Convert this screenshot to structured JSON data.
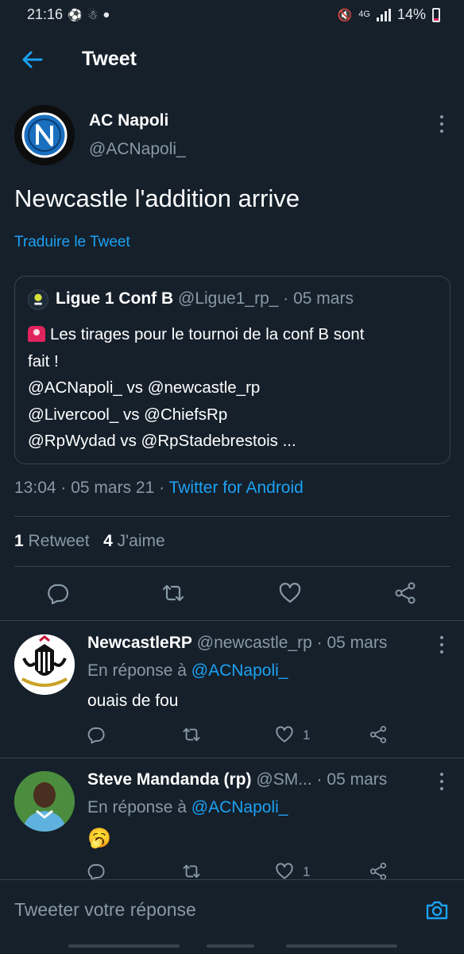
{
  "status_bar": {
    "time": "21:16",
    "network": "4G",
    "battery": "14%"
  },
  "header": {
    "title": "Tweet"
  },
  "tweet": {
    "author_name": "AC Napoli",
    "author_handle": "@ACNapoli_",
    "text": "Newcastle l'addition arrive",
    "translate_label": "Traduire le Tweet",
    "quoted": {
      "author_name": "Ligue 1 Conf B",
      "author_handle": "@Ligue1_rp_",
      "separator": " · ",
      "date": "05 mars",
      "lines": [
        "Les tirages pour le tournoi de la conf B sont",
        "fait !",
        "@ACNapoli_ vs @newcastle_rp",
        "@Livercool_ vs @ChiefsRp",
        "@RpWydad vs @RpStadebrestois ..."
      ]
    },
    "time": "13:04",
    "separator": " · ",
    "date": "05 mars 21",
    "source": "Twitter for Android",
    "retweets_count": "1",
    "retweets_label": "Retweet",
    "likes_count": "4",
    "likes_label": "J'aime"
  },
  "replies": [
    {
      "name": "NewcastleRP",
      "handle": "@newcastle_rp",
      "separator": " · ",
      "date": "05 mars",
      "reply_prefix": "En réponse à ",
      "reply_to": "@ACNapoli_",
      "text": "ouais de fou",
      "likes": "1"
    },
    {
      "name": "Steve Mandanda (rp)",
      "handle": "@SM...",
      "separator": " · ",
      "date": "05 mars",
      "reply_prefix": "En réponse à ",
      "reply_to": "@ACNapoli_",
      "text": "🥱",
      "likes": "1"
    }
  ],
  "compose": {
    "placeholder": "Tweeter votre réponse"
  },
  "colors": {
    "background": "#15202b",
    "accent": "#1da1f2",
    "muted": "#8899a6",
    "border": "#38444d"
  },
  "icons": [
    "back-arrow-icon",
    "more-icon",
    "reply-icon",
    "retweet-icon",
    "like-icon",
    "share-icon",
    "camera-icon"
  ]
}
